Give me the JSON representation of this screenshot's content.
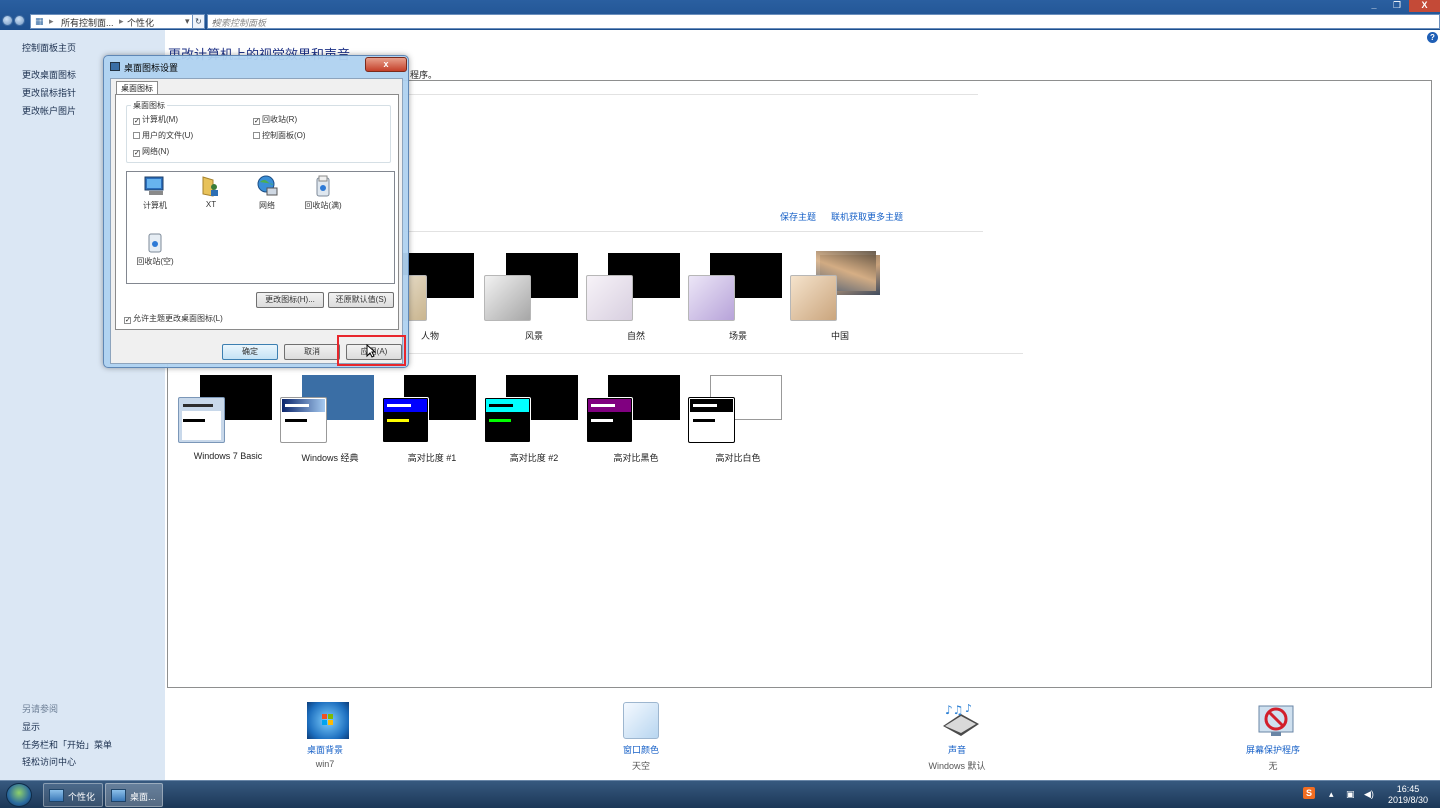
{
  "window": {
    "breadcrumb": [
      "所有控制面...",
      "个性化"
    ],
    "search_placeholder": "搜索控制面板",
    "controls": [
      "_",
      "❐",
      "X"
    ]
  },
  "sidebar": {
    "home": "控制面板主页",
    "links": [
      "更改桌面图标",
      "更改鼠标指针",
      "更改帐户图片"
    ],
    "see_also_header": "另请参阅",
    "see_also": [
      "显示",
      "任务栏和「开始」菜单",
      "轻松访问中心"
    ]
  },
  "main": {
    "title": "更改计算机上的视觉效果和声音",
    "description_tail": "程序。",
    "save_theme": "保存主题",
    "more_themes": "联机获取更多主题",
    "aero_themes": [
      {
        "name": "人物",
        "color": "#c9b58f"
      },
      {
        "name": "风景",
        "color": "#a6a6a6"
      },
      {
        "name": "自然",
        "color": "#d8cfe0"
      },
      {
        "name": "场景",
        "color": "#b7a3d9"
      },
      {
        "name": "中国",
        "color": "#e6c6a2"
      }
    ],
    "basic_themes": [
      {
        "name": "Windows 7 Basic"
      },
      {
        "name": "Windows 经典"
      },
      {
        "name": "高对比度 #1"
      },
      {
        "name": "高对比度 #2"
      },
      {
        "name": "高对比黑色"
      },
      {
        "name": "高对比白色"
      }
    ],
    "bottom_items": [
      {
        "label": "桌面背景",
        "value": "win7",
        "icon": "desktop-background-icon"
      },
      {
        "label": "窗口颜色",
        "value": "天空",
        "icon": "window-color-icon"
      },
      {
        "label": "声音",
        "value": "Windows 默认",
        "icon": "sound-icon"
      },
      {
        "label": "屏幕保护程序",
        "value": "无",
        "icon": "screensaver-icon"
      }
    ]
  },
  "dialog": {
    "title": "桌面图标设置",
    "close": "x",
    "tab": "桌面图标",
    "group_label": "桌面图标",
    "checkboxes": [
      {
        "label": "计算机(M)",
        "checked": true
      },
      {
        "label": "回收站(R)",
        "checked": true
      },
      {
        "label": "用户的文件(U)",
        "checked": false
      },
      {
        "label": "控制面板(O)",
        "checked": false
      },
      {
        "label": "网络(N)",
        "checked": true
      }
    ],
    "icons": [
      {
        "label": "计算机",
        "icon": "computer-icon"
      },
      {
        "label": "XT",
        "icon": "user-folder-icon"
      },
      {
        "label": "网络",
        "icon": "network-icon"
      },
      {
        "label": "回收站(满)",
        "icon": "recycle-bin-full-icon"
      },
      {
        "label": "回收站(空)",
        "icon": "recycle-bin-empty-icon"
      }
    ],
    "change_icon": "更改图标(H)...",
    "restore_default": "还原默认值(S)",
    "allow_themes": "允许主题更改桌面图标(L)",
    "allow_themes_checked": true,
    "ok": "确定",
    "cancel": "取消",
    "apply": "应用(A)"
  },
  "taskbar": {
    "buttons": [
      "个性化",
      "桌面..."
    ],
    "time": "16:45",
    "date": "2019/8/30",
    "tray_icons": [
      "sogou-ime-icon",
      "show-hidden-icon",
      "network-icon",
      "volume-icon"
    ]
  }
}
